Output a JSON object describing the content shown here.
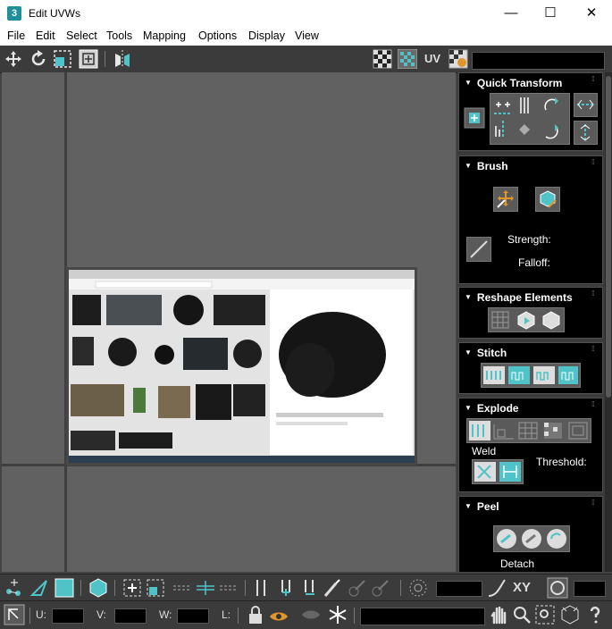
{
  "window": {
    "title": "Edit UVWs",
    "app_icon": "3",
    "controls": {
      "minimize": "—",
      "maximize": "☐",
      "close": "✕"
    }
  },
  "menu": [
    "File",
    "Edit",
    "Select",
    "Tools",
    "Mapping",
    "Options",
    "Display",
    "View"
  ],
  "toolbar": {
    "uv_label": "UV",
    "icons": [
      "move-icon",
      "rotate-icon",
      "scale-icon",
      "freeform-icon",
      "mirror-icon",
      "checker-icon",
      "checker-pattern-icon",
      "uv-label",
      "map-options-icon"
    ]
  },
  "panels": {
    "quick_transform": {
      "title": "Quick Transform"
    },
    "brush": {
      "title": "Brush",
      "strength_label": "Strength:",
      "falloff_label": "Falloff:"
    },
    "reshape": {
      "title": "Reshape Elements"
    },
    "stitch": {
      "title": "Stitch"
    },
    "explode": {
      "title": "Explode",
      "weld_label": "Weld",
      "threshold_label": "Threshold:"
    },
    "peel": {
      "title": "Peel",
      "detach_label": "Detach"
    }
  },
  "bottom": {
    "xy_label": "XY",
    "u_label": "U:",
    "v_label": "V:",
    "w_label": "W:",
    "l_label": "L:"
  },
  "colors": {
    "accent": "#4fc3c8",
    "panel_bg": "#000000",
    "viewport_bg": "#616161"
  }
}
